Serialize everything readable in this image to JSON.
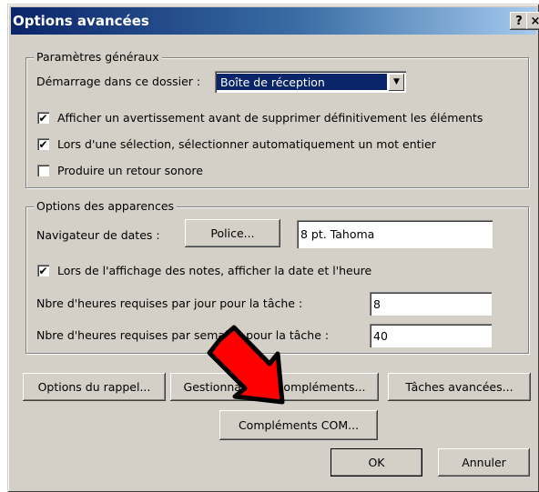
{
  "window": {
    "title": "Options avancées",
    "help_label": "?",
    "close_label": "×"
  },
  "general": {
    "legend": "Paramètres généraux",
    "start_folder_label": "Démarrage dans ce dossier :",
    "start_folder_value": "Boîte de réception",
    "checkboxes": [
      {
        "label": "Afficher un avertissement avant de supprimer définitivement les éléments",
        "checked": true,
        "mark": "✔"
      },
      {
        "label": "Lors d'une sélection, sélectionner automatiquement un mot entier",
        "checked": true,
        "mark": "✔"
      },
      {
        "label": "Produire un retour sonore",
        "checked": false,
        "mark": ""
      }
    ]
  },
  "appearance": {
    "legend": "Options des apparences",
    "date_nav_label": "Navigateur de dates :",
    "font_button": "Police...",
    "font_value": "8 pt. Tahoma",
    "notes_checkbox": {
      "label": "Lors de l'affichage des notes, afficher la date et l'heure",
      "checked": true,
      "mark": "✔"
    },
    "hours_day_label": "Nbre d'heures requises par jour pour la tâche :",
    "hours_day_value": "8",
    "hours_week_label": "Nbre d'heures requises par semaine pour la tâche :",
    "hours_week_value": "40"
  },
  "buttons": {
    "reminder": "Options du rappel...",
    "addin_manager": "Gestionnaire de compléments...",
    "advanced_tasks": "Tâches avancées...",
    "com_addins": "Compléments COM...",
    "ok": "OK",
    "cancel": "Annuler"
  },
  "annotation": {
    "arrow_color": "#ff0000"
  }
}
